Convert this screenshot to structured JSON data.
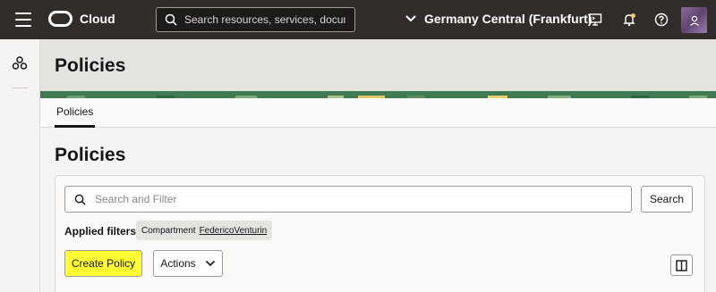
{
  "topbar": {
    "brand": "Cloud",
    "search_placeholder": "Search resources, services, documentation, and Marketplace",
    "region": "Germany Central (Frankfurt)",
    "icons": [
      "cloud-shell-icon",
      "notifications-icon",
      "help-icon",
      "profile-icon"
    ]
  },
  "header": {
    "title": "Policies"
  },
  "tabs": [
    {
      "label": "Policies"
    }
  ],
  "main": {
    "title": "Policies",
    "filter_placeholder": "Search and Filter",
    "search_button": "Search",
    "applied_filters_label": "Applied filters",
    "chip": {
      "label": "Compartment",
      "value": "FedericoVenturin"
    },
    "create_button": "Create Policy",
    "actions_button": "Actions"
  },
  "colors": {
    "topbar_bg": "#312d2a",
    "create_highlight": "#ffff33",
    "banner_green": "#3f7a52"
  }
}
